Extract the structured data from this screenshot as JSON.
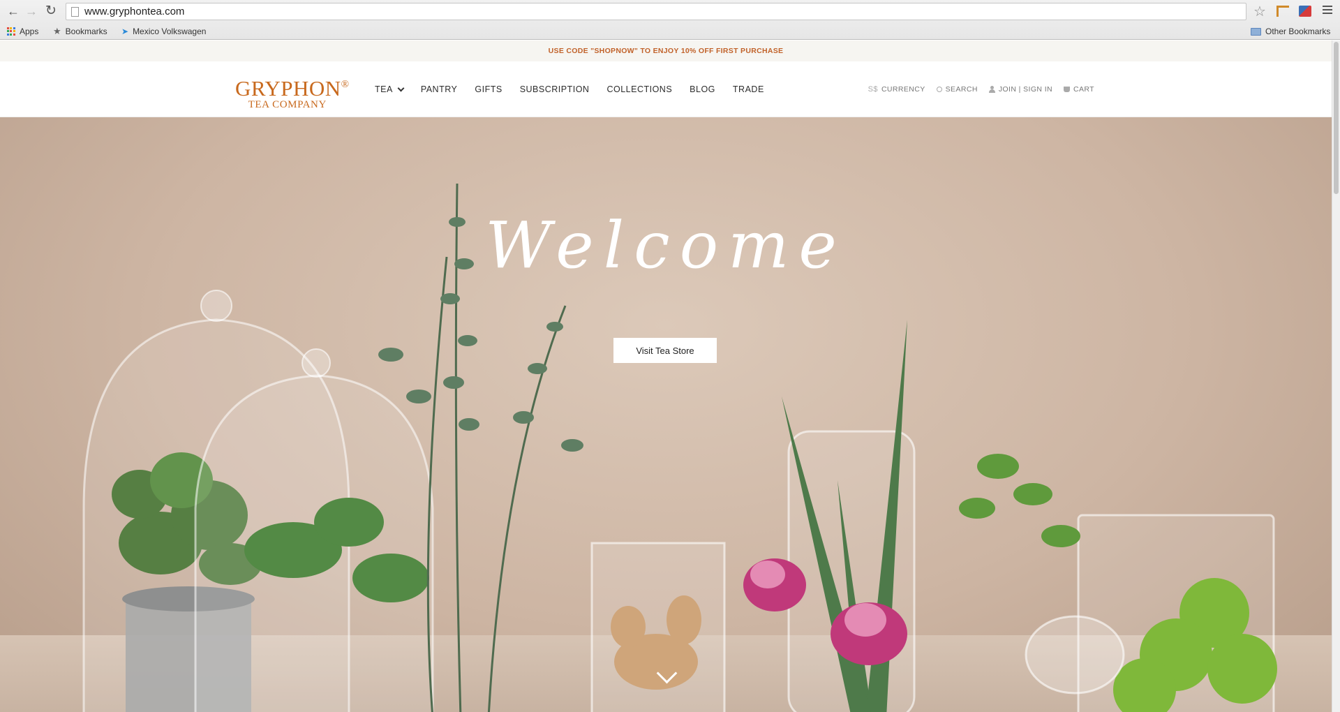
{
  "browser": {
    "url": "www.gryphontea.com",
    "bookmarks": [
      {
        "label": "Apps",
        "icon": "apps-grid-icon"
      },
      {
        "label": "Bookmarks",
        "icon": "star-icon"
      },
      {
        "label": "Mexico Volkswagen",
        "icon": "bird-icon"
      }
    ],
    "other_bookmarks": "Other Bookmarks"
  },
  "promo": {
    "text": "USE CODE \"SHOPNOW\" TO ENJOY 10% OFF FIRST PURCHASE"
  },
  "logo": {
    "line1": "GRYPHON",
    "reg": "®",
    "line2": "TEA COMPANY"
  },
  "nav": {
    "items": [
      "TEA",
      "PANTRY",
      "GIFTS",
      "SUBSCRIPTION",
      "COLLECTIONS",
      "BLOG",
      "TRADE"
    ]
  },
  "util": {
    "currency_symbol": "S$",
    "currency": "CURRENCY",
    "search": "SEARCH",
    "account": "JOIN | SIGN IN",
    "cart": "CART"
  },
  "hero": {
    "headline": "Welcome",
    "cta": "Visit Tea Store"
  },
  "colors": {
    "accent": "#c1622a",
    "hero_background": "#cdb5a3"
  }
}
